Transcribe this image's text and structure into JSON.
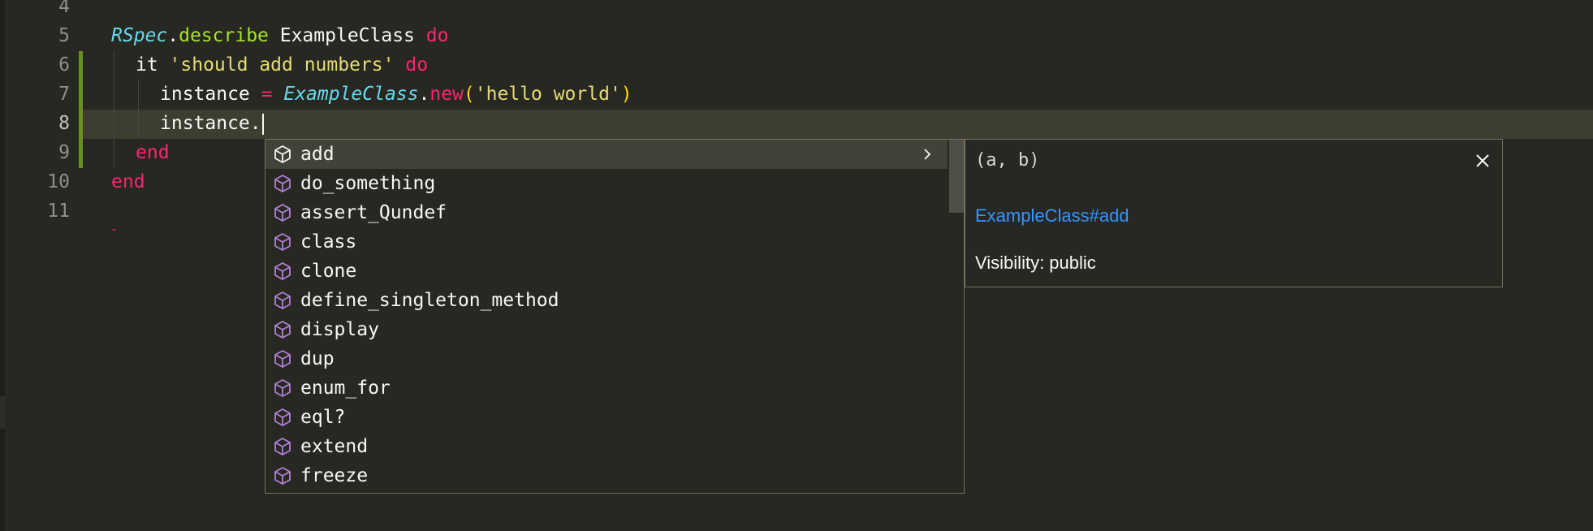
{
  "colors": {
    "background": "#272822",
    "keyword": "#f92672",
    "string": "#e6db74",
    "method": "#a6e22e",
    "constant": "#66d9ef",
    "link": "#3794ff",
    "modified_bar": "#6b8e23",
    "suggest_icon": "#b180d7"
  },
  "editor": {
    "line_numbers": [
      "4",
      "5",
      "6",
      "7",
      "8",
      "9",
      "10",
      "11"
    ],
    "active_line": "8",
    "lines": {
      "l5": {
        "t1": "RSpec",
        "t2": ".",
        "t3": "describe",
        "t4": " ExampleClass ",
        "t5": "do"
      },
      "l6": {
        "t1": "it ",
        "t2": "'should add numbers'",
        "t3": " ",
        "t4": "do"
      },
      "l7": {
        "t1": "instance ",
        "t2": "=",
        "t3": " ",
        "t4": "ExampleClass",
        "t5": ".",
        "t6": "new",
        "t7": "(",
        "t8": "'hello world'",
        "t9": ")"
      },
      "l8": {
        "t1": "instance."
      },
      "l9": {
        "t1": "end"
      },
      "l10": {
        "t1": "end"
      }
    },
    "squiggle": "˷"
  },
  "suggest": {
    "icon": "symbol-method-cube-icon",
    "more_icon": "chevron-right-icon",
    "items": [
      {
        "label": "add"
      },
      {
        "label": "do_something"
      },
      {
        "label": "assert_Qundef"
      },
      {
        "label": "class"
      },
      {
        "label": "clone"
      },
      {
        "label": "define_singleton_method"
      },
      {
        "label": "display"
      },
      {
        "label": "dup"
      },
      {
        "label": "enum_for"
      },
      {
        "label": "eql?"
      },
      {
        "label": "extend"
      },
      {
        "label": "freeze"
      }
    ],
    "more_glyph": "›"
  },
  "details": {
    "signature": "(a, b)",
    "link": "ExampleClass#add",
    "visibility": "Visibility: public",
    "close_icon": "close-icon"
  }
}
